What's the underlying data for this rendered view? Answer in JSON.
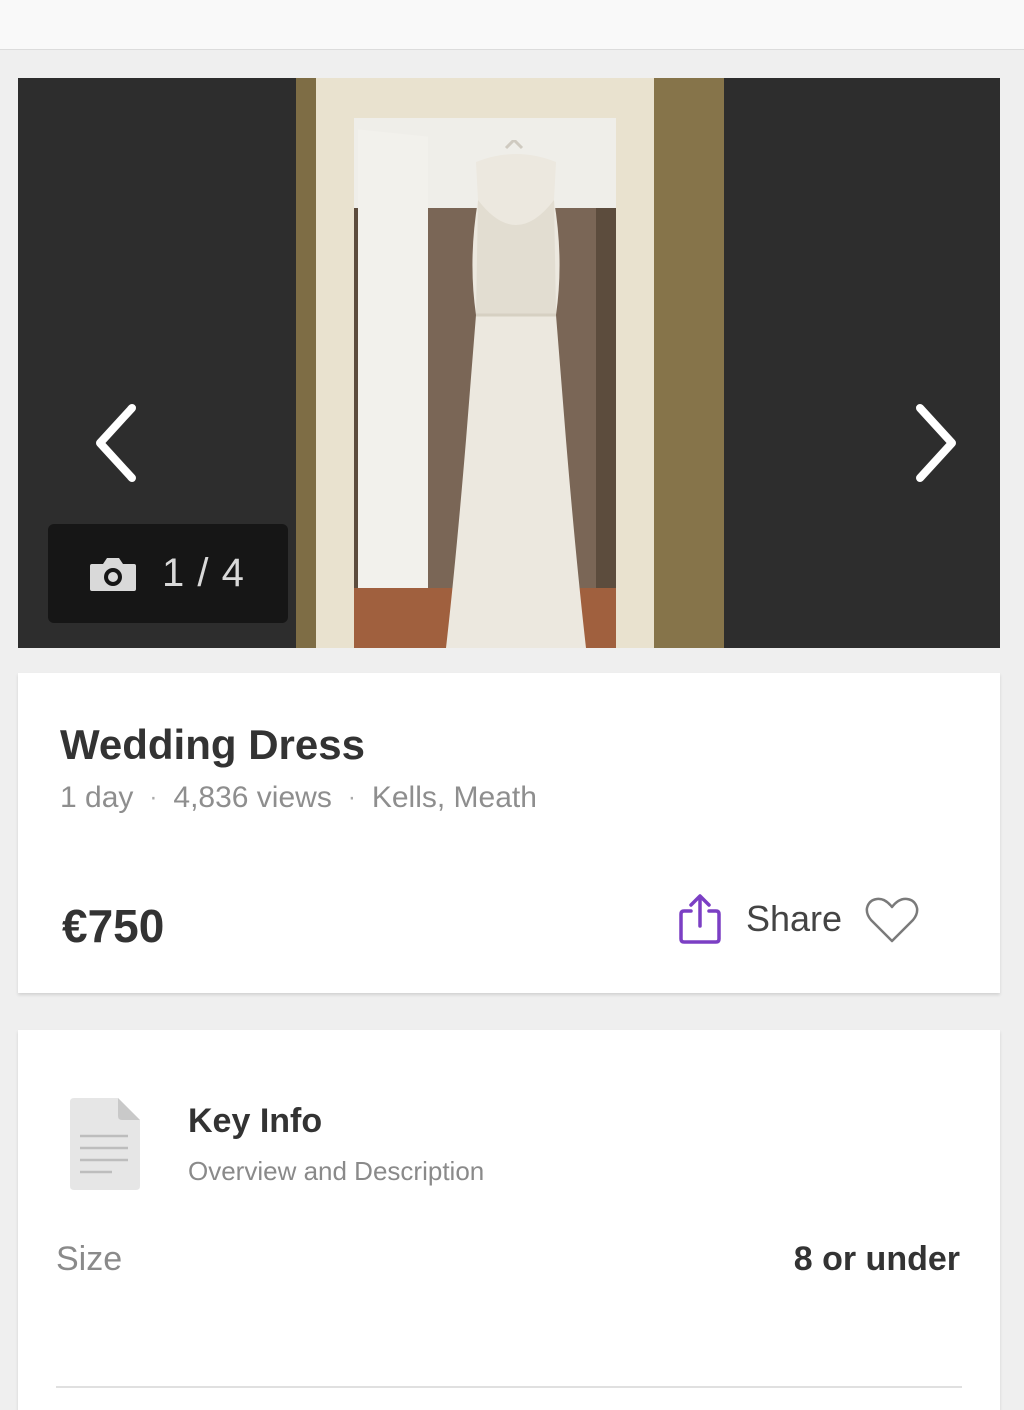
{
  "gallery": {
    "counter_text": "1 / 4",
    "prev_icon": "chevron-left-icon",
    "next_icon": "chevron-right-icon",
    "camera_icon": "camera-icon"
  },
  "listing": {
    "title": "Wedding Dress",
    "age": "1 day",
    "views": "4,836 views",
    "location": "Kells, Meath",
    "separator": "·",
    "price": "€750",
    "share_label": "Share",
    "share_icon": "share-icon",
    "favourite_icon": "heart-icon"
  },
  "key_info": {
    "title": "Key Info",
    "subtitle": "Overview and Description",
    "icon": "document-icon",
    "fields": [
      {
        "label": "Size",
        "value": "8 or under"
      }
    ]
  },
  "colors": {
    "accent": "#7b3fc4",
    "background": "#efefef",
    "gallery_bg": "#2d2d2d"
  }
}
